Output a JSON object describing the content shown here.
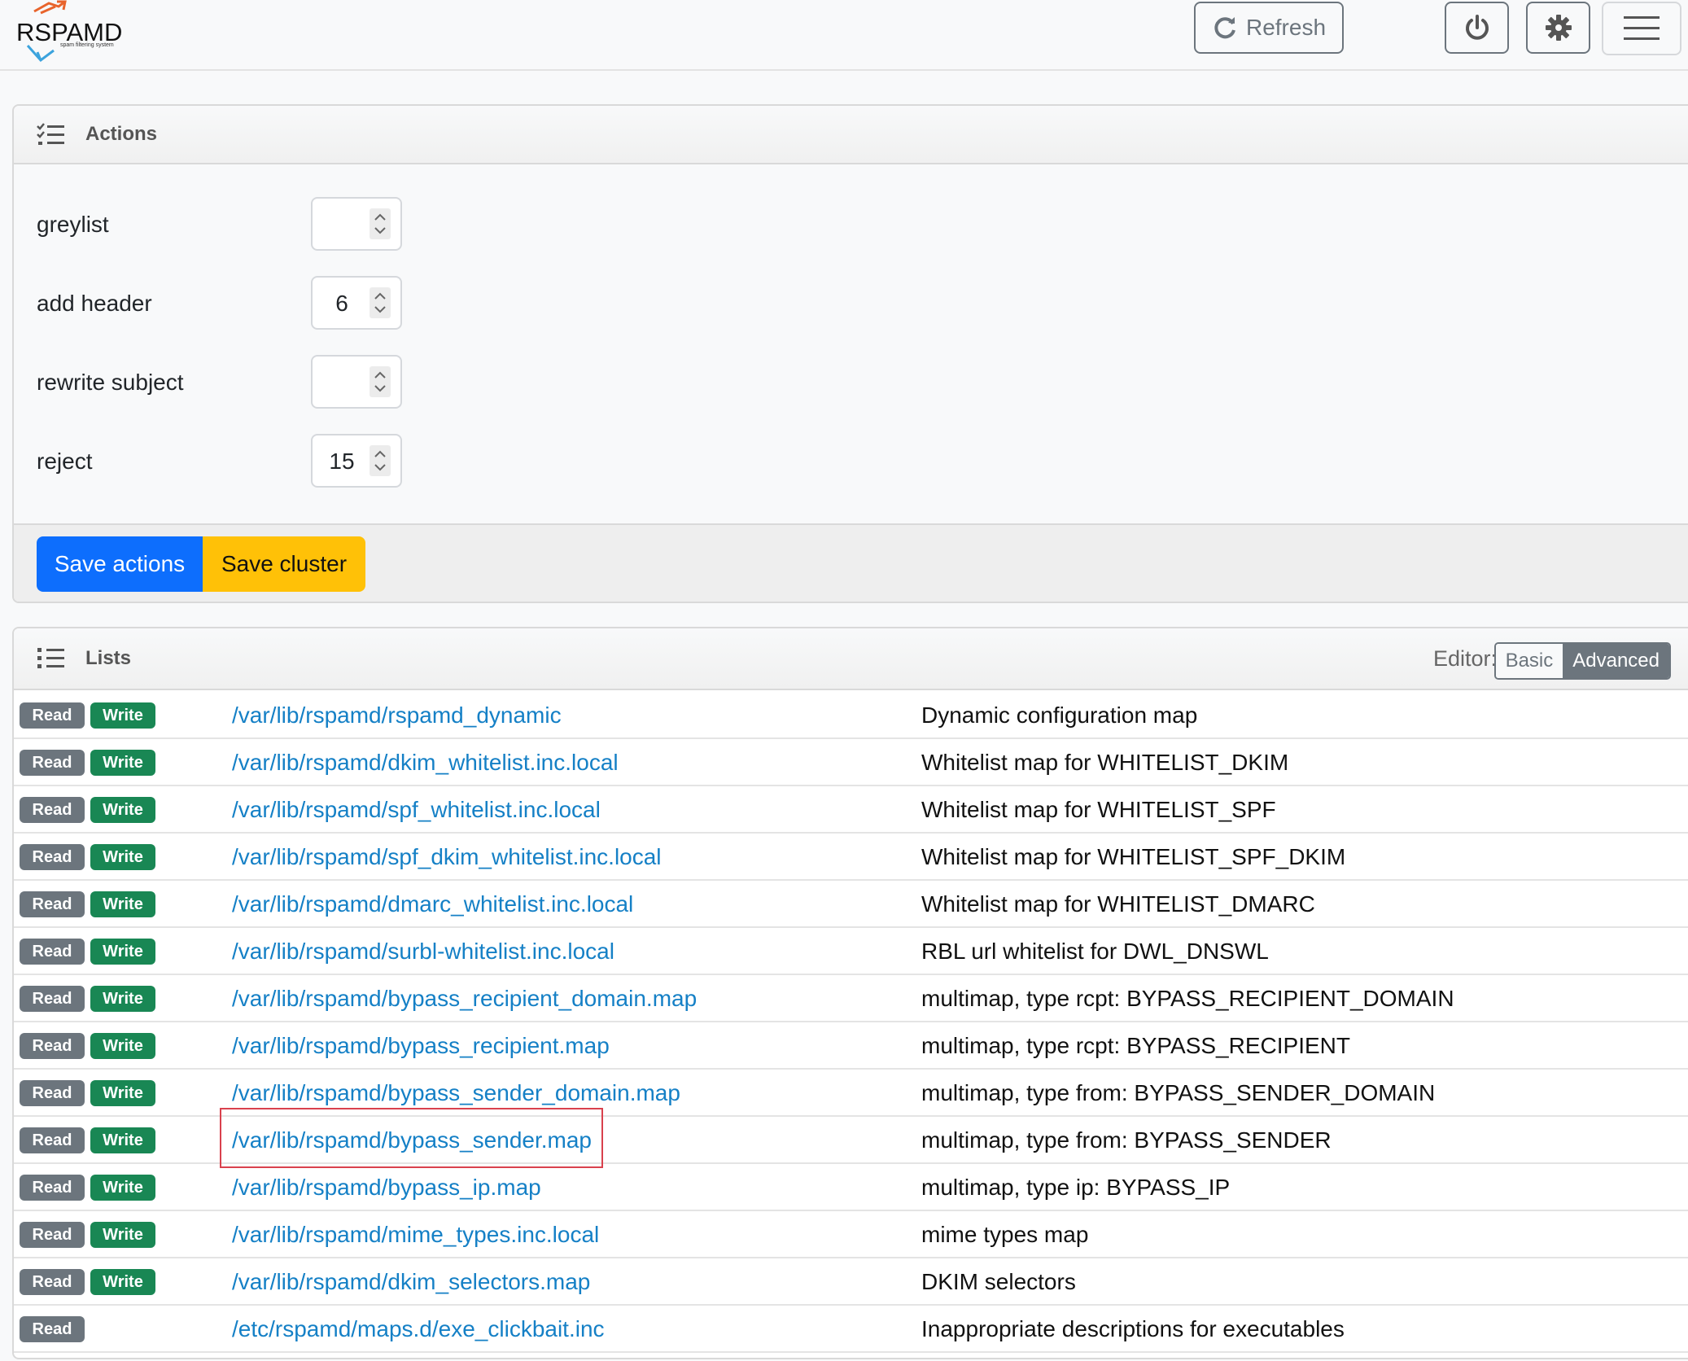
{
  "app": {
    "logo_text": "RSPAMD",
    "logo_sub": "spam filtering system"
  },
  "navbar": {
    "refresh_label": "Refresh"
  },
  "actions": {
    "title": "Actions",
    "fields": [
      {
        "label": "greylist",
        "value": ""
      },
      {
        "label": "add header",
        "value": "6"
      },
      {
        "label": "rewrite subject",
        "value": ""
      },
      {
        "label": "reject",
        "value": "15"
      }
    ],
    "save_actions_label": "Save actions",
    "save_cluster_label": "Save cluster"
  },
  "lists": {
    "title": "Lists",
    "editor_label": "Editor:",
    "editor_basic": "Basic",
    "editor_advanced": "Advanced",
    "read_label": "Read",
    "write_label": "Write",
    "rows": [
      {
        "path": "/var/lib/rspamd/rspamd_dynamic",
        "desc": "Dynamic configuration map",
        "write": true
      },
      {
        "path": "/var/lib/rspamd/dkim_whitelist.inc.local",
        "desc": "Whitelist map for WHITELIST_DKIM",
        "write": true
      },
      {
        "path": "/var/lib/rspamd/spf_whitelist.inc.local",
        "desc": "Whitelist map for WHITELIST_SPF",
        "write": true
      },
      {
        "path": "/var/lib/rspamd/spf_dkim_whitelist.inc.local",
        "desc": "Whitelist map for WHITELIST_SPF_DKIM",
        "write": true
      },
      {
        "path": "/var/lib/rspamd/dmarc_whitelist.inc.local",
        "desc": "Whitelist map for WHITELIST_DMARC",
        "write": true
      },
      {
        "path": "/var/lib/rspamd/surbl-whitelist.inc.local",
        "desc": "RBL url whitelist for DWL_DNSWL",
        "write": true
      },
      {
        "path": "/var/lib/rspamd/bypass_recipient_domain.map",
        "desc": "multimap, type rcpt: BYPASS_RECIPIENT_DOMAIN",
        "write": true
      },
      {
        "path": "/var/lib/rspamd/bypass_recipient.map",
        "desc": "multimap, type rcpt: BYPASS_RECIPIENT",
        "write": true
      },
      {
        "path": "/var/lib/rspamd/bypass_sender_domain.map",
        "desc": "multimap, type from: BYPASS_SENDER_DOMAIN",
        "write": true
      },
      {
        "path": "/var/lib/rspamd/bypass_sender.map",
        "desc": "multimap, type from: BYPASS_SENDER",
        "write": true
      },
      {
        "path": "/var/lib/rspamd/bypass_ip.map",
        "desc": "multimap, type ip: BYPASS_IP",
        "write": true
      },
      {
        "path": "/var/lib/rspamd/mime_types.inc.local",
        "desc": "mime types map",
        "write": true
      },
      {
        "path": "/var/lib/rspamd/dkim_selectors.map",
        "desc": "DKIM selectors",
        "write": true
      },
      {
        "path": "/etc/rspamd/maps.d/exe_clickbait.inc",
        "desc": "Inappropriate descriptions for executables",
        "write": false
      }
    ]
  },
  "colors": {
    "primary": "#0d6efd",
    "warning": "#ffc107",
    "success": "#198754",
    "secondary": "#6c757d",
    "link": "#1580c6",
    "highlight": "#d9414d"
  }
}
